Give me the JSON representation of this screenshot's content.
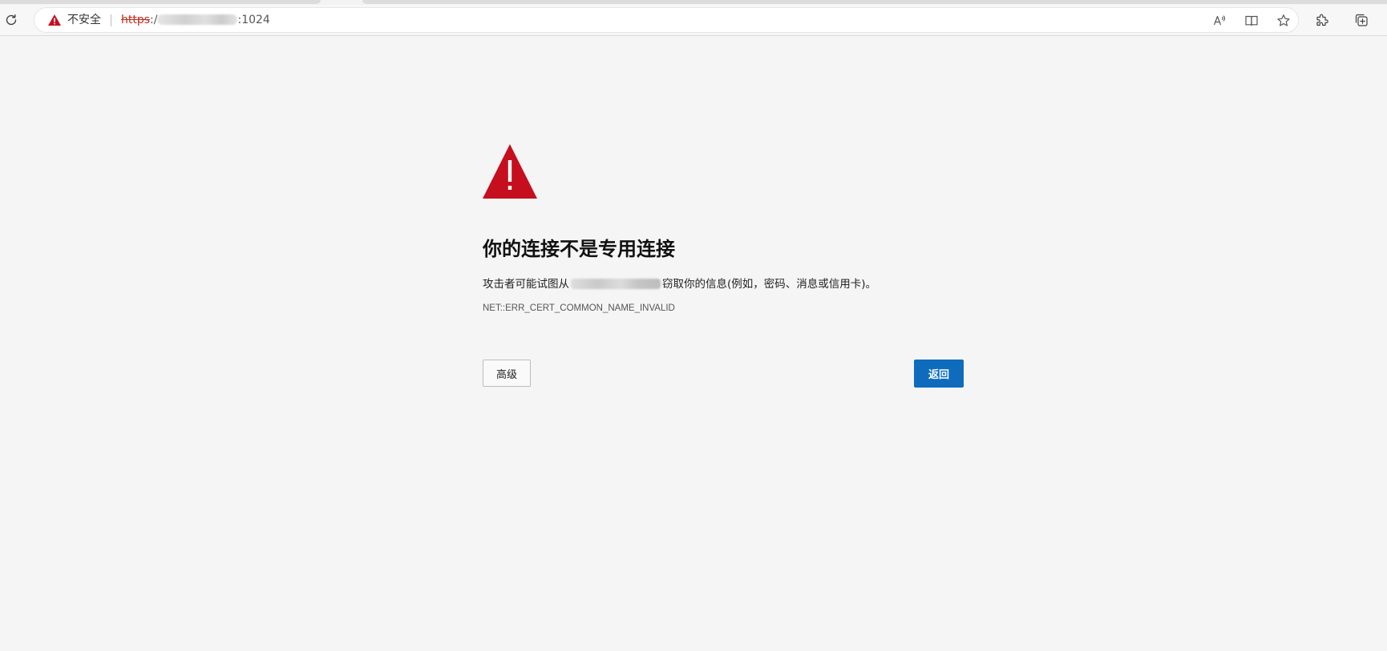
{
  "browser": {
    "security_label": "不安全",
    "url_scheme": "https",
    "url_separator": ":/",
    "url_port_suffix": ":1024",
    "icons": {
      "refresh": "refresh-icon",
      "not_secure": "warning-triangle-icon",
      "read_aloud": "read-aloud-icon",
      "immersive_reader": "immersive-reader-icon",
      "favorite": "star-icon",
      "extensions": "puzzle-icon",
      "collections": "collections-icon"
    }
  },
  "error_page": {
    "heading": "你的连接不是专用连接",
    "description_prefix": "攻击者可能试图从",
    "description_suffix": "窃取你的信息(例如，密码、消息或信用卡)。",
    "error_code": "NET::ERR_CERT_COMMON_NAME_INVALID",
    "advanced_button": "高级",
    "back_button": "返回",
    "warning_color": "#c50f1f",
    "accent_color": "#0f6cbd"
  }
}
